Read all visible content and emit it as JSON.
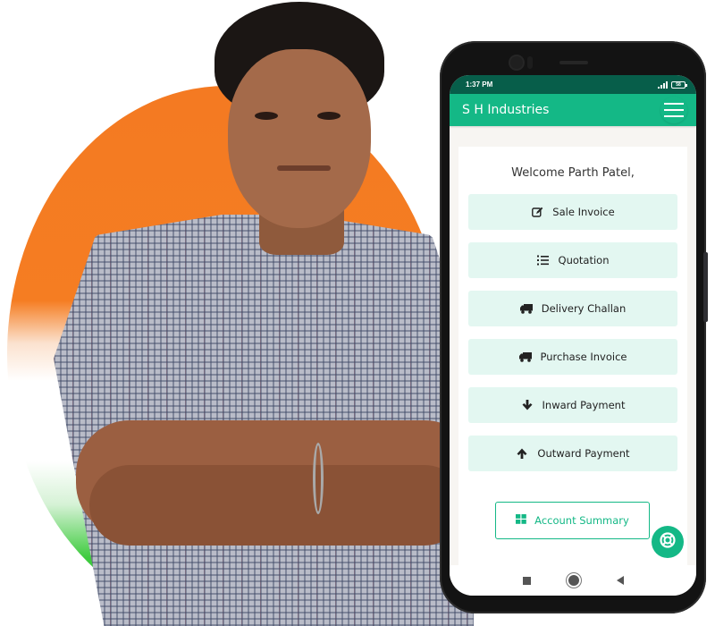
{
  "colors": {
    "accent": "#14b886",
    "status_bar": "#075e4a",
    "menu_item_bg": "#e3f7f1",
    "flag_saffron": "#f47a22",
    "flag_green": "#2fbf3a"
  },
  "status_bar": {
    "time": "1:37 PM",
    "signal_icon": "signal-icon",
    "battery_icon": "battery-icon",
    "battery_level": "58"
  },
  "app_bar": {
    "title": "S H Industries",
    "menu_icon": "hamburger-menu-icon"
  },
  "welcome_text": "Welcome Parth Patel,",
  "menu_items": [
    {
      "label": "Sale Invoice",
      "icon": "edit-icon"
    },
    {
      "label": "Quotation",
      "icon": "list-ordered-icon"
    },
    {
      "label": "Delivery Challan",
      "icon": "truck-icon"
    },
    {
      "label": "Purchase Invoice",
      "icon": "truck-icon"
    },
    {
      "label": "Inward Payment",
      "icon": "arrow-down-icon"
    },
    {
      "label": "Outward Payment",
      "icon": "arrow-up-icon"
    }
  ],
  "account_summary": {
    "label": "Account Summary",
    "icon": "grid-icon"
  },
  "help_fab": {
    "icon": "lifebuoy-icon"
  },
  "nav_bar": {
    "recent": "recent-apps-icon",
    "home": "home-icon",
    "back": "back-icon"
  }
}
